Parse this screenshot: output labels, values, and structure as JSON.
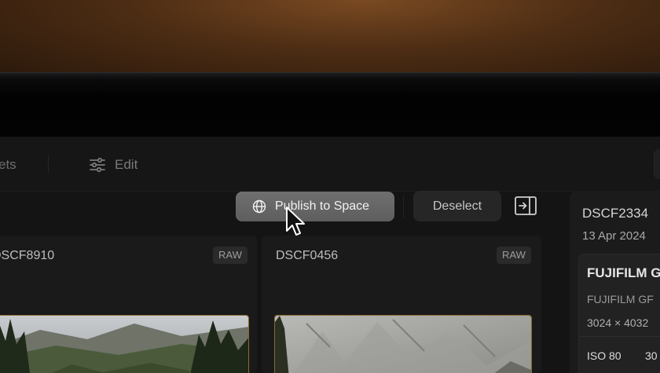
{
  "toolbar": {
    "tab_partial_label": "ets",
    "edit_label": "Edit"
  },
  "actions": {
    "publish_label": "Publish to Space",
    "deselect_label": "Deselect"
  },
  "grid": {
    "items": [
      {
        "name": "DSCF8910",
        "badge": "RAW"
      },
      {
        "name": "DSCF0456",
        "badge": "RAW"
      }
    ]
  },
  "details": {
    "file_name": "DSCF2334",
    "date": "13 Apr 2024",
    "camera_make": "FUJIFILM G",
    "camera_model": "FUJIFILM GF",
    "resolution": "3024 × 4032",
    "iso": "ISO 80",
    "shutter": "30"
  },
  "colors": {
    "accent_border": "#8a6a30",
    "publish_bg": "#666666",
    "panel_bg": "#1b1b1b"
  },
  "icons": [
    "sliders-icon",
    "globe-icon",
    "panel-toggle-icon",
    "cursor-icon"
  ]
}
